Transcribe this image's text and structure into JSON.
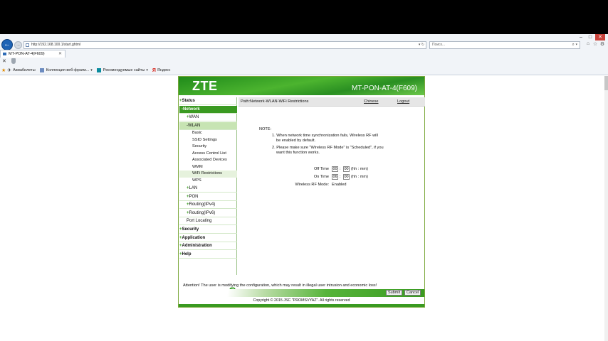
{
  "browser": {
    "address": "http://192.168.100.1/start.ghtml",
    "search_placeholder": "Поиск...",
    "tab_title": "MT-PON-AT-4(F609)",
    "favorites": [
      {
        "label": "Авиабилеты"
      },
      {
        "label": "Коллекция веб-фрагм..."
      },
      {
        "label": "Рекомендуемые сайты"
      },
      {
        "label": "Яндекс"
      }
    ]
  },
  "router": {
    "logo": "ZTE",
    "model": "MT-PON-AT-4(F609)",
    "path": "Path:Network-WLAN-WiFi Restrictions",
    "links": {
      "chinese": "Chinese",
      "logout": "Logout"
    },
    "sidebar": {
      "status": "Status",
      "network": "-Network",
      "wan": "WAN",
      "wlan": "-WLAN",
      "wlan_sub": [
        "Basic",
        "SSID Settings",
        "Security",
        "Access Control List",
        "Associated Devices",
        "WMM",
        "WiFi Restrictions",
        "WPS"
      ],
      "lan": "LAN",
      "pon": "PON",
      "routing4": "Routing(IPv4)",
      "routing6": "Routing(IPv6)",
      "port_locating": "Port Locating",
      "security": "Security",
      "application": "Application",
      "administration": "Administration",
      "help": "Help",
      "help_icon": "?"
    },
    "note": {
      "title": "NOTE:",
      "line1a": "1. When network time synchronization fails, Wireless RF will",
      "line1b": "be enabled by default.",
      "line2a": "2. Please make sure \"Wireless RF Mode\" is \"Scheduled\", if you",
      "line2b": "want this function works."
    },
    "form": {
      "off_time_label": "Off Time",
      "off_hh": "00",
      "off_mm": "00",
      "on_time_label": "On Time",
      "on_hh": "06",
      "on_mm": "00",
      "sep": ":",
      "unit": "(hh : mm)",
      "rf_mode_label": "Wireless RF Mode:",
      "rf_mode_value": "Enabled"
    },
    "attention": "Attention! The user is modifying the configuration, which may result in illegal user intrusion and economic loss!",
    "buttons": {
      "submit": "Submit",
      "cancel": "Cancel"
    },
    "copyright": "Copyright © 2015 JSC \"PROMSVYAZ\". All rights reserved"
  }
}
